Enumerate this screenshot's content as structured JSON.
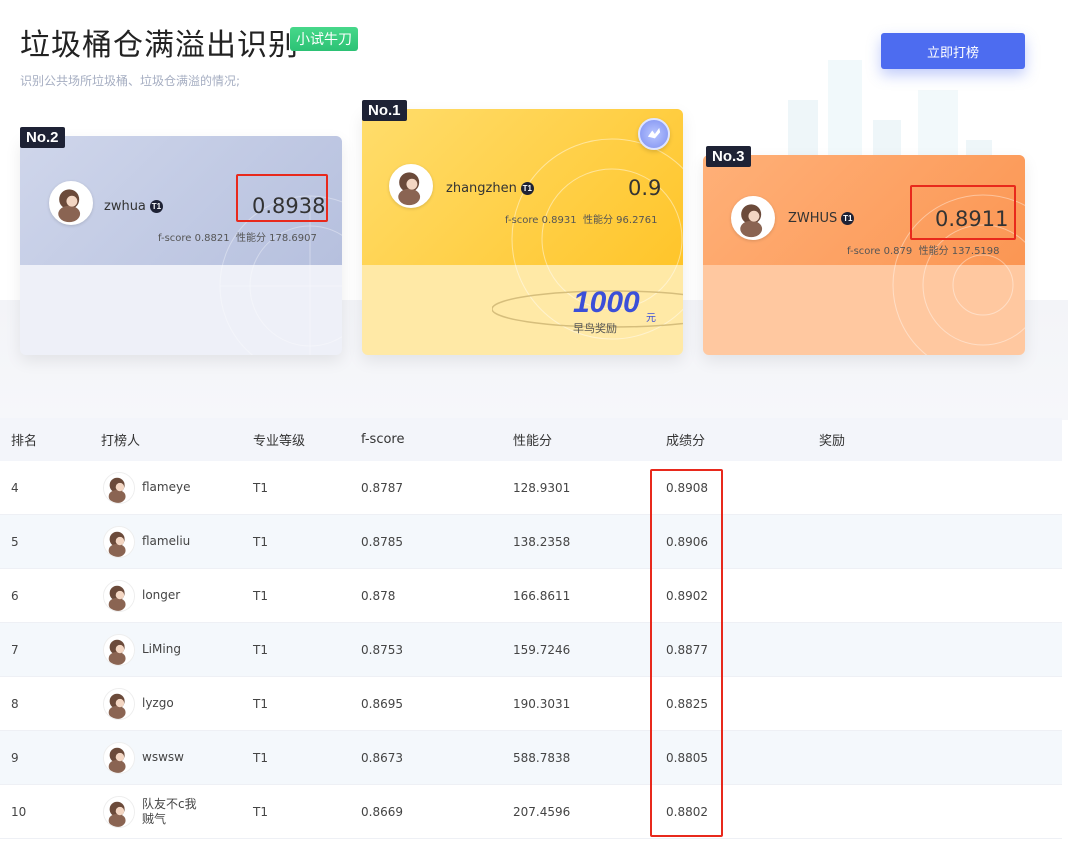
{
  "header": {
    "title": "垃圾桶仓满溢出识别",
    "badge": "小试牛刀",
    "subtitle": "识别公共场所垃圾桶、垃圾仓满溢的情况;",
    "rank_button": "立即打榜"
  },
  "podium": [
    {
      "rank": "No.2",
      "name": "zwhua",
      "level": "T1",
      "score": "0.8938",
      "fscore": "f-score 0.8821",
      "perf": "性能分 178.6907",
      "highlighted": true
    },
    {
      "rank": "No.1",
      "name": "zhangzhen",
      "level": "T1",
      "score": "0.9",
      "fscore": "f-score 0.8931",
      "perf": "性能分 96.2761",
      "prize_amount": "1000",
      "prize_unit": "元",
      "prize_label": "早鸟奖励",
      "highlighted": false
    },
    {
      "rank": "No.3",
      "name": "ZWHUS",
      "level": "T1",
      "score": "0.8911",
      "fscore": "f-score 0.879",
      "perf": "性能分 137.5198",
      "highlighted": true
    }
  ],
  "table": {
    "columns": [
      "排名",
      "打榜人",
      "专业等级",
      "f-score",
      "性能分",
      "成绩分",
      "奖励"
    ],
    "rows": [
      {
        "rank": "4",
        "name": "flameye",
        "level": "T1",
        "fscore": "0.8787",
        "perf": "128.9301",
        "score": "0.8908",
        "reward": ""
      },
      {
        "rank": "5",
        "name": "flameliu",
        "level": "T1",
        "fscore": "0.8785",
        "perf": "138.2358",
        "score": "0.8906",
        "reward": ""
      },
      {
        "rank": "6",
        "name": "longer",
        "level": "T1",
        "fscore": "0.878",
        "perf": "166.8611",
        "score": "0.8902",
        "reward": ""
      },
      {
        "rank": "7",
        "name": "LiMing",
        "level": "T1",
        "fscore": "0.8753",
        "perf": "159.7246",
        "score": "0.8877",
        "reward": ""
      },
      {
        "rank": "8",
        "name": "lyzgo",
        "level": "T1",
        "fscore": "0.8695",
        "perf": "190.3031",
        "score": "0.8825",
        "reward": ""
      },
      {
        "rank": "9",
        "name": "wswsw",
        "level": "T1",
        "fscore": "0.8673",
        "perf": "588.7838",
        "score": "0.8805",
        "reward": ""
      },
      {
        "rank": "10",
        "name": "队友不c我\n贼气",
        "level": "T1",
        "fscore": "0.8669",
        "perf": "207.4596",
        "score": "0.8802",
        "reward": ""
      }
    ]
  },
  "colors": {
    "accent": "#4d6cf0",
    "badge_green": "#2cc275",
    "highlight_red": "#e8291c",
    "card2": "#c2cbe4",
    "card1": "#ffd24a",
    "card3": "#fca061"
  },
  "icons": [
    "avatar-icon",
    "level-badge-icon",
    "medal-icon"
  ]
}
